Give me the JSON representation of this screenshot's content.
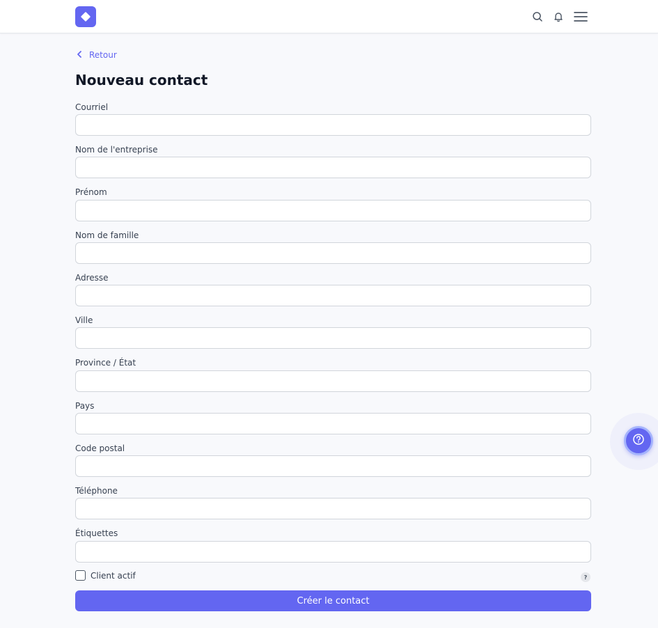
{
  "header": {
    "logo_icon": "diamond-icon",
    "brand_color": "#6366f1",
    "icons": [
      "search-icon",
      "bell-icon",
      "menu-icon"
    ]
  },
  "nav": {
    "back_label": "Retour"
  },
  "page": {
    "title": "Nouveau contact"
  },
  "form": {
    "fields": [
      {
        "label": "Courriel",
        "value": ""
      },
      {
        "label": "Nom de l'entreprise",
        "value": ""
      },
      {
        "label": "Prénom",
        "value": ""
      },
      {
        "label": "Nom de famille",
        "value": ""
      },
      {
        "label": "Adresse",
        "value": ""
      },
      {
        "label": "Ville",
        "value": ""
      },
      {
        "label": "Province / État",
        "value": ""
      },
      {
        "label": "Pays",
        "value": ""
      },
      {
        "label": "Code postal",
        "value": ""
      },
      {
        "label": "Téléphone",
        "value": ""
      },
      {
        "label": "Étiquettes",
        "value": ""
      }
    ],
    "active_checkbox_label": "Client actif",
    "active_checked": false,
    "help_badge": "?",
    "submit_label": "Créer le contact"
  },
  "help_fab_icon": "help-circle-icon"
}
